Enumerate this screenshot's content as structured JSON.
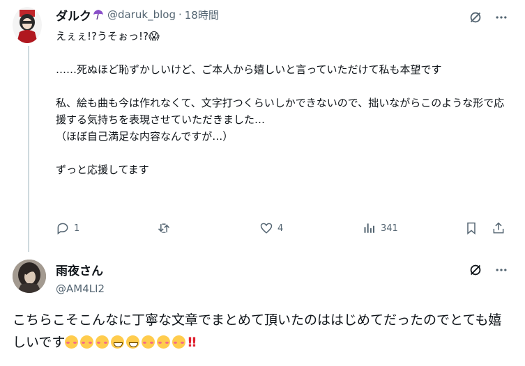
{
  "tweet1": {
    "display_name": "ダルク",
    "handle": "@daruk_blog",
    "separator": "·",
    "time": "18時間",
    "text": "えぇぇ!?うそぉっ!?😱\n\n……死ぬほど恥ずかしいけど、ご本人から嬉しいと言っていただけて私も本望です\n\n私、絵も曲も今は作れなくて、文字打つくらいしかできないので、拙いながらこのような形で応援する気持ちを表現させていただきました…\n（ほぼ自己満足な内容なんですが…）\n\nずっと応援してます",
    "actions": {
      "replies": "1",
      "reposts": "",
      "likes": "4",
      "views": "341"
    }
  },
  "tweet2": {
    "display_name": "雨夜さん",
    "handle": "@AM4LI2",
    "text": "こちらこそこんなに丁寧な文章でまとめて頂いたのははじめてだったのでとても嬉しいです",
    "emoji_sequence": [
      "kissing-face",
      "kissing-face",
      "kissing-face",
      "grinning-face",
      "grinning-face",
      "kissing-face",
      "kissing-face",
      "kissing-face",
      "double-exclamation"
    ],
    "double_exclamation": "‼"
  },
  "colors": {
    "muted": "#536471",
    "thread_line": "#cfd9de",
    "text": "#0f1419"
  }
}
